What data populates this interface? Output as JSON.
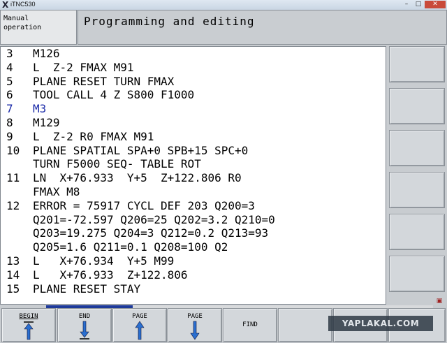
{
  "window": {
    "title": "iTNC530",
    "app_icon": "X",
    "minimize": "–",
    "maximize": "□",
    "close": "✕"
  },
  "header": {
    "mode_left_line1": "Manual",
    "mode_left_line2": "operation",
    "mode_right": "Programming and editing"
  },
  "program": {
    "lines": [
      {
        "num": "3",
        "text": "M126"
      },
      {
        "num": "4",
        "text": "L  Z-2 FMAX M91"
      },
      {
        "num": "5",
        "text": "PLANE RESET TURN FMAX"
      },
      {
        "num": "6",
        "text": "TOOL CALL 4 Z S800 F1000"
      },
      {
        "num": "7",
        "text": "M3"
      },
      {
        "num": "8",
        "text": "M129"
      },
      {
        "num": "9",
        "text": "L  Z-2 R0 FMAX M91"
      },
      {
        "num": "10",
        "text": "PLANE SPATIAL SPA+0 SPB+15 SPC+0"
      },
      {
        "num": "",
        "text": "TURN F5000 SEQ- TABLE ROT"
      },
      {
        "num": "11",
        "text": "LN  X+76.933  Y+5  Z+122.806 R0"
      },
      {
        "num": "",
        "text": "FMAX M8"
      },
      {
        "num": "12",
        "text": "ERROR = 75917 CYCL DEF 203 Q200=3"
      },
      {
        "num": "",
        "text": "Q201=-72.597 Q206=25 Q202=3.2 Q210=0"
      },
      {
        "num": "",
        "text": "Q203=19.275 Q204=3 Q212=0.2 Q213=93"
      },
      {
        "num": "",
        "text": "Q205=1.6 Q211=0.1 Q208=100 Q2"
      },
      {
        "num": "13",
        "text": "L   X+76.934  Y+5 M99"
      },
      {
        "num": "14",
        "text": "L   X+76.933  Z+122.806"
      },
      {
        "num": "15",
        "text": "PLANE RESET STAY"
      }
    ],
    "active_line_index": 4,
    "active_color": "#1a2aa8"
  },
  "softkeys": {
    "begin": "BEGIN",
    "end": "END",
    "page_up": "PAGE",
    "page_down": "PAGE",
    "find": "FIND"
  },
  "watermark": "YAPLAKAL.COM",
  "colors": {
    "tab_indicator": "#1e3a9a",
    "arrow_blue": "#2a6fd0"
  }
}
